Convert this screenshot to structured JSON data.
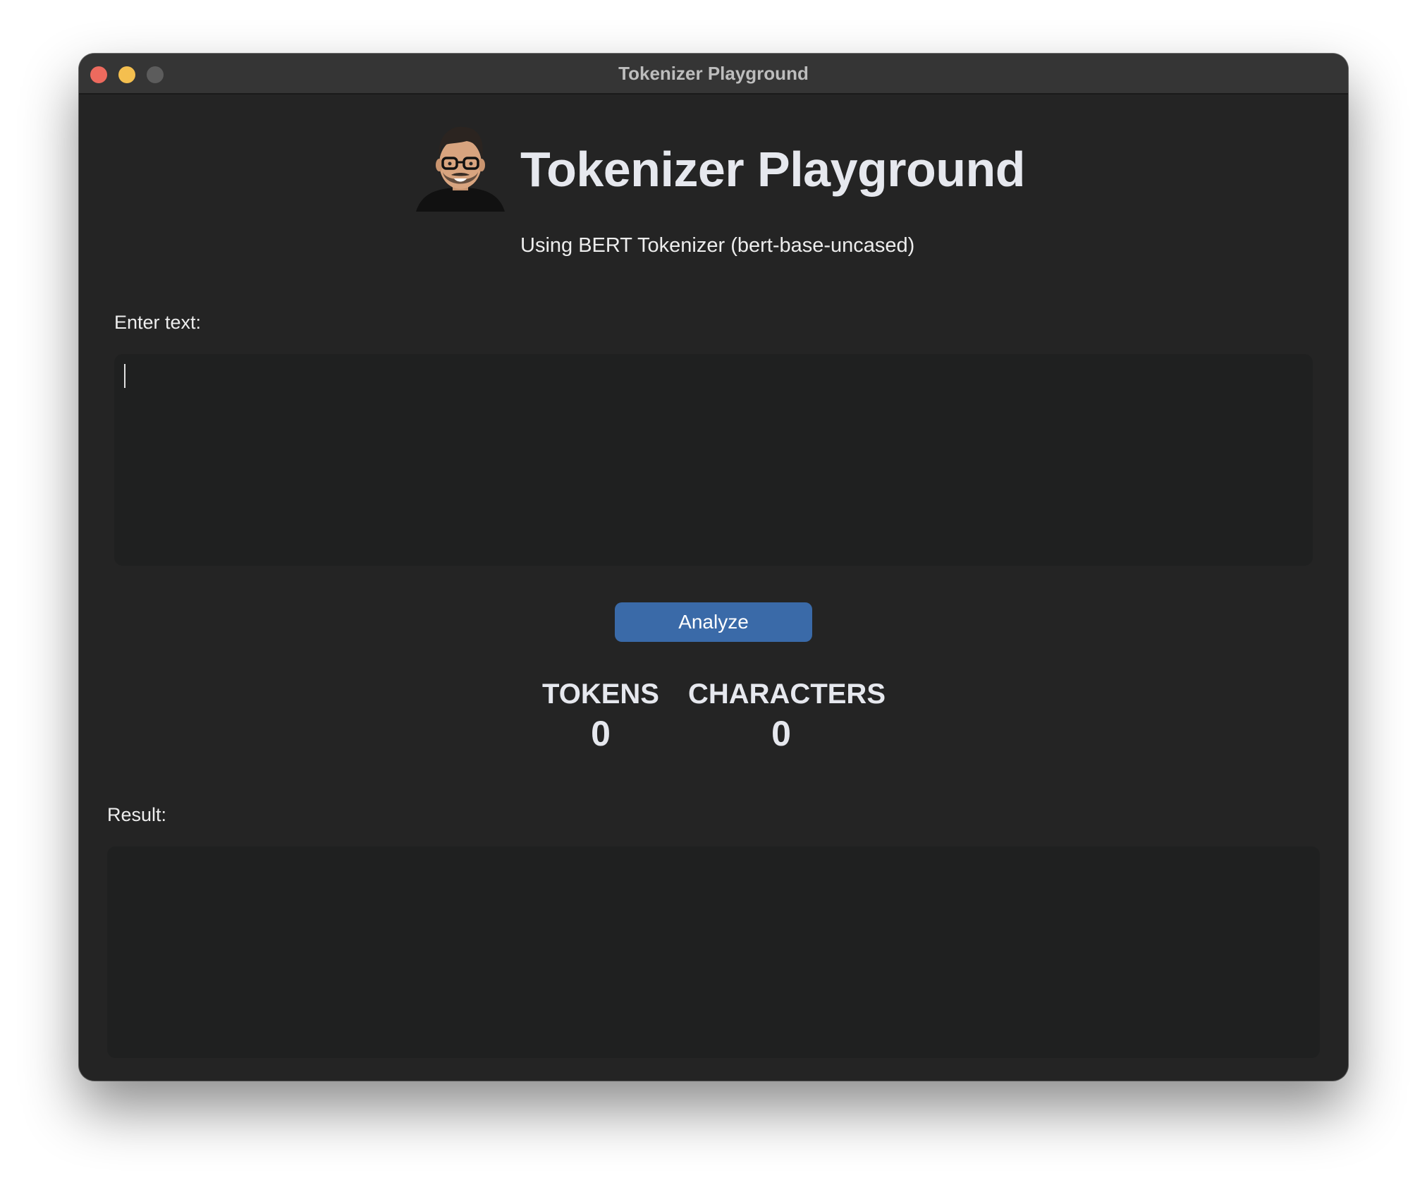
{
  "window": {
    "title": "Tokenizer Playground"
  },
  "header": {
    "title": "Tokenizer Playground",
    "subtitle": "Using BERT Tokenizer (bert-base-uncased)",
    "avatar_icon": "cartoon-avatar-icon"
  },
  "input": {
    "label": "Enter text:",
    "value": "",
    "placeholder": ""
  },
  "actions": {
    "analyze_label": "Analyze",
    "accent_color": "#3a6aa8"
  },
  "stats": {
    "tokens_label": "TOKENS",
    "tokens_value": "0",
    "characters_label": "CHARACTERS",
    "characters_value": "0"
  },
  "result": {
    "label": "Result:",
    "value": ""
  }
}
